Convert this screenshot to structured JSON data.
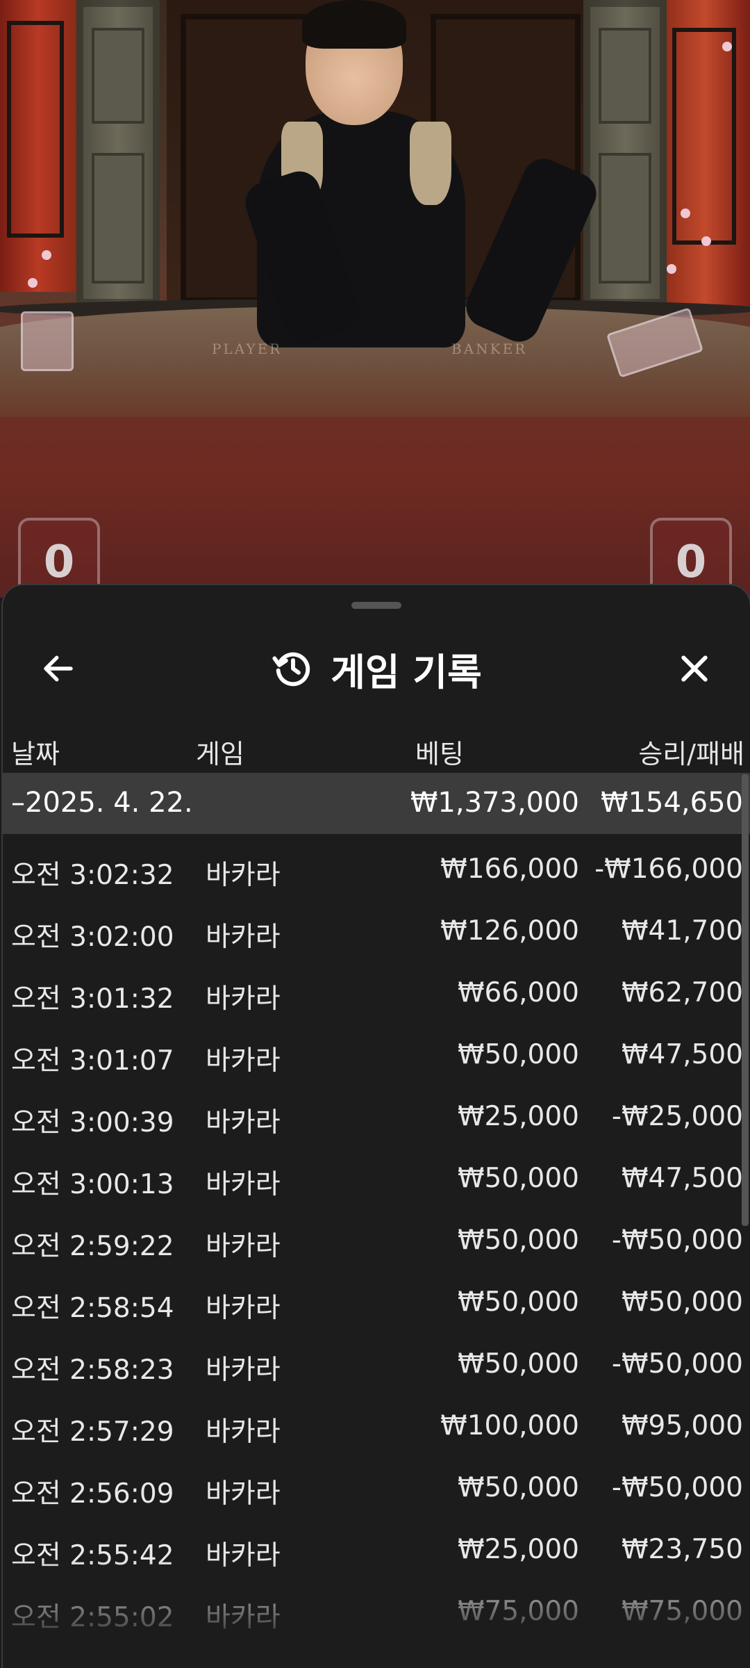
{
  "video": {
    "table_label_left": "PLAYER",
    "table_label_right": "BANKER",
    "player_score": "0",
    "banker_score": "0"
  },
  "sheet": {
    "title": "게임 기록",
    "icons": {
      "back": "arrow-left-icon",
      "history": "history-icon",
      "close": "close-icon"
    },
    "columns": {
      "date": "날짜",
      "game": "게임",
      "bet": "베팅",
      "result": "승리/패배"
    },
    "group": {
      "date": "–2025. 4. 22.",
      "bet_total": "₩1,373,000",
      "result_total": "₩154,650"
    },
    "rows": [
      {
        "time": "오전 3:02:32",
        "game": "바카라",
        "bet": "₩166,000",
        "result": "-₩166,000"
      },
      {
        "time": "오전 3:02:00",
        "game": "바카라",
        "bet": "₩126,000",
        "result": "₩41,700"
      },
      {
        "time": "오전 3:01:32",
        "game": "바카라",
        "bet": "₩66,000",
        "result": "₩62,700"
      },
      {
        "time": "오전 3:01:07",
        "game": "바카라",
        "bet": "₩50,000",
        "result": "₩47,500"
      },
      {
        "time": "오전 3:00:39",
        "game": "바카라",
        "bet": "₩25,000",
        "result": "-₩25,000"
      },
      {
        "time": "오전 3:00:13",
        "game": "바카라",
        "bet": "₩50,000",
        "result": "₩47,500"
      },
      {
        "time": "오전 2:59:22",
        "game": "바카라",
        "bet": "₩50,000",
        "result": "-₩50,000"
      },
      {
        "time": "오전 2:58:54",
        "game": "바카라",
        "bet": "₩50,000",
        "result": "₩50,000"
      },
      {
        "time": "오전 2:58:23",
        "game": "바카라",
        "bet": "₩50,000",
        "result": "-₩50,000"
      },
      {
        "time": "오전 2:57:29",
        "game": "바카라",
        "bet": "₩100,000",
        "result": "₩95,000"
      },
      {
        "time": "오전 2:56:09",
        "game": "바카라",
        "bet": "₩50,000",
        "result": "-₩50,000"
      },
      {
        "time": "오전 2:55:42",
        "game": "바카라",
        "bet": "₩25,000",
        "result": "₩23,750"
      },
      {
        "time": "오전 2:55:02",
        "game": "바카라",
        "bet": "₩75,000",
        "result": "₩75,000"
      }
    ]
  },
  "colors": {
    "sheet_bg": "#1c1c1c",
    "group_row_bg": "#3c3c3c",
    "text": "#e8e8e8"
  }
}
